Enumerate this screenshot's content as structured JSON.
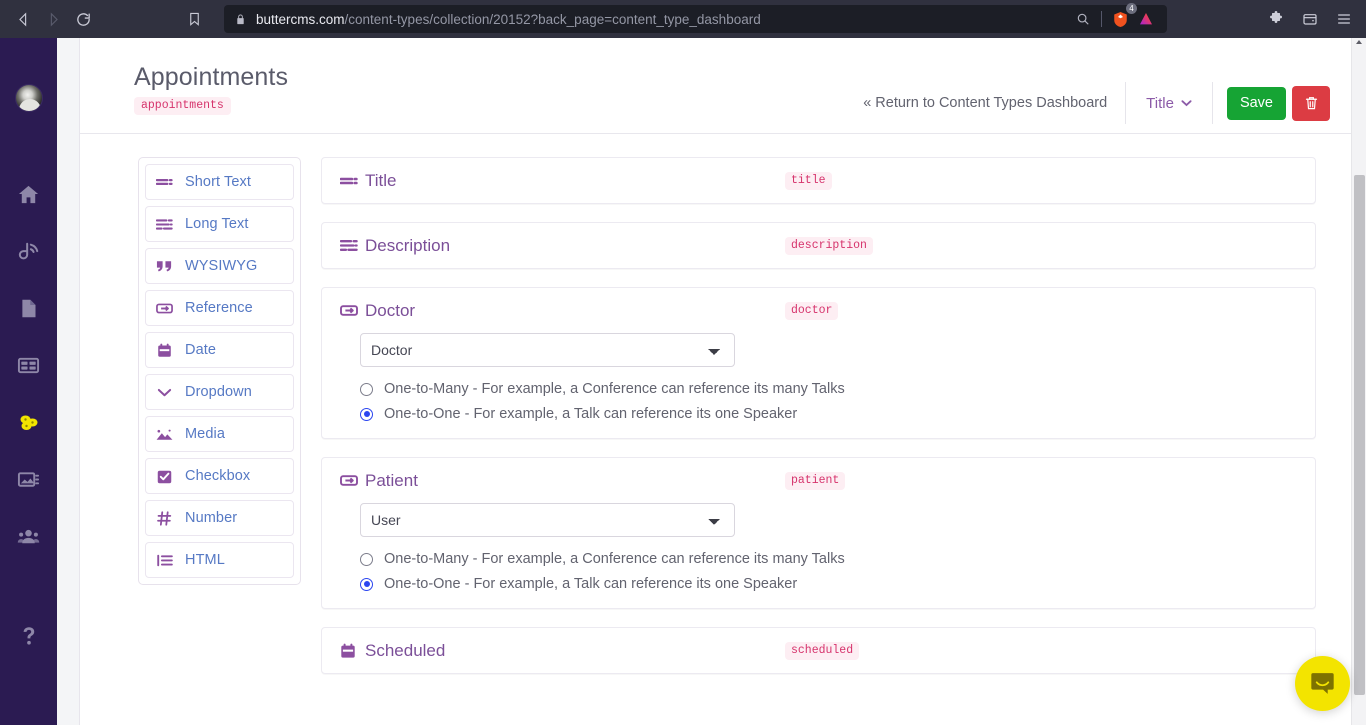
{
  "browser": {
    "url_host": "buttercms.com",
    "url_path": "/content-types/collection/20152?back_page=content_type_dashboard",
    "back_label": "Back",
    "forward_label": "Forward",
    "reload_label": "Reload",
    "bookmark_label": "Bookmark this tab",
    "search_icon": "search-icon",
    "lock_icon": "lock-icon",
    "brave_shield_count": "4",
    "extensions_label": "Extensions",
    "wallet_label": "Brave Wallet",
    "menu_label": "Customize and control Brave"
  },
  "app_sidebar": {
    "avatar_label": "User avatar",
    "items": [
      {
        "icon": "home-icon",
        "label": "Home"
      },
      {
        "icon": "blog-icon",
        "label": "Blog"
      },
      {
        "icon": "pages-icon",
        "label": "Pages"
      },
      {
        "icon": "collections-icon",
        "label": "Collections"
      },
      {
        "icon": "content-types-icon",
        "label": "Content Types"
      },
      {
        "icon": "media-icon",
        "label": "Media"
      },
      {
        "icon": "team-icon",
        "label": "Team"
      },
      {
        "icon": "help-icon",
        "label": "Help"
      }
    ]
  },
  "header": {
    "title": "Appointments",
    "slug": "appointments",
    "return_link": "« Return to Content Types Dashboard",
    "title_dropdown": "Title",
    "save_label": "Save",
    "delete_icon": "trash-icon"
  },
  "palette": {
    "items": [
      {
        "icon": "short-text-icon",
        "label": "Short Text"
      },
      {
        "icon": "long-text-icon",
        "label": "Long Text"
      },
      {
        "icon": "wysiwyg-icon",
        "label": "WYSIWYG"
      },
      {
        "icon": "reference-icon",
        "label": "Reference"
      },
      {
        "icon": "date-icon",
        "label": "Date"
      },
      {
        "icon": "dropdown-icon",
        "label": "Dropdown"
      },
      {
        "icon": "media-icon",
        "label": "Media"
      },
      {
        "icon": "checkbox-icon",
        "label": "Checkbox"
      },
      {
        "icon": "number-icon",
        "label": "Number"
      },
      {
        "icon": "html-icon",
        "label": "HTML"
      }
    ]
  },
  "fields": [
    {
      "icon": "short-text-icon",
      "name": "Title",
      "slug": "title",
      "type": "short-text"
    },
    {
      "icon": "long-text-icon",
      "name": "Description",
      "slug": "description",
      "type": "long-text"
    },
    {
      "icon": "reference-icon",
      "name": "Doctor",
      "slug": "doctor",
      "type": "reference",
      "select_value": "Doctor",
      "select_options": [
        "Doctor",
        "User"
      ],
      "relations": [
        {
          "label": "One-to-Many - For example, a Conference can reference its many Talks",
          "selected": false
        },
        {
          "label": "One-to-One - For example, a Talk can reference its one Speaker",
          "selected": true
        }
      ]
    },
    {
      "icon": "reference-icon",
      "name": "Patient",
      "slug": "patient",
      "type": "reference",
      "select_value": "User",
      "select_options": [
        "Doctor",
        "User"
      ],
      "relations": [
        {
          "label": "One-to-Many - For example, a Conference can reference its many Talks",
          "selected": false
        },
        {
          "label": "One-to-One - For example, a Talk can reference its one Speaker",
          "selected": true
        }
      ]
    },
    {
      "icon": "date-icon",
      "name": "Scheduled",
      "slug": "scheduled",
      "type": "date"
    }
  ],
  "widget": {
    "intercom_label": "Open Intercom Messenger",
    "icon": "chat-bubble-icon"
  },
  "colors": {
    "brand_purple": "#2b1b52",
    "accent_purple": "#8c4fa0",
    "slug_pink": "#d6336c",
    "slug_bg": "#fdeef3",
    "save_green": "#16a434",
    "delete_red": "#dc3c43",
    "radio_blue": "#2b46f0",
    "palette_link": "#5679c4",
    "intercom_yellow": "#f3e400",
    "chrome_bg": "#30313f",
    "omnibox_bg": "#1c1e26"
  }
}
